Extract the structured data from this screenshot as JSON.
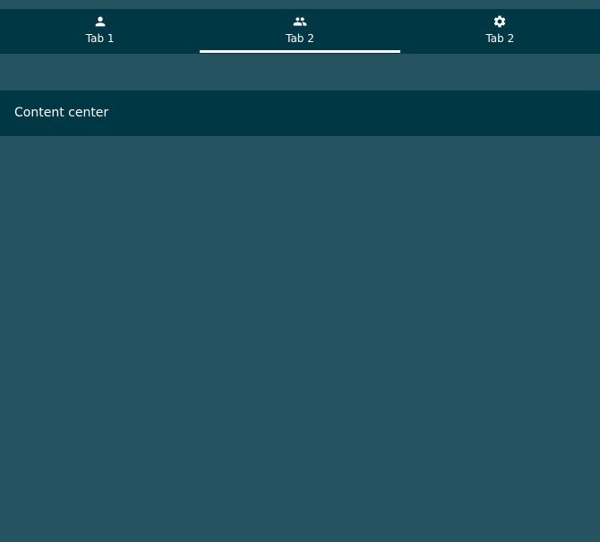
{
  "tabs": [
    {
      "label": "Tab 1",
      "icon": "person-icon",
      "active": false
    },
    {
      "label": "Tab 2",
      "icon": "group-icon",
      "active": true
    },
    {
      "label": "Tab 2",
      "icon": "gear-icon",
      "active": false
    }
  ],
  "content": {
    "text": "Content center"
  },
  "colors": {
    "background": "#255460",
    "bar": "#003745",
    "indicator": "#ffffff",
    "text": "#ffffff"
  }
}
